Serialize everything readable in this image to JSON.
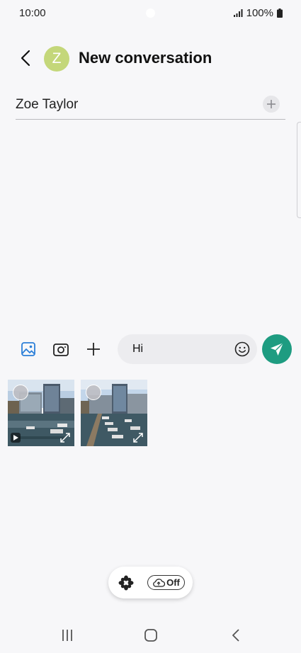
{
  "status_bar": {
    "time": "10:00",
    "battery": "100%"
  },
  "header": {
    "title": "New conversation",
    "avatar_letter": "Z"
  },
  "recipient": {
    "name": "Zoe Taylor"
  },
  "compose": {
    "message": "Hi"
  },
  "attachments": [
    {
      "type": "video"
    },
    {
      "type": "image"
    }
  ],
  "cloud_toggle": {
    "label": "Off"
  },
  "colors": {
    "accent": "#1e9c81",
    "avatar": "#c4d77a",
    "gallery_icon": "#2c7fd8"
  }
}
